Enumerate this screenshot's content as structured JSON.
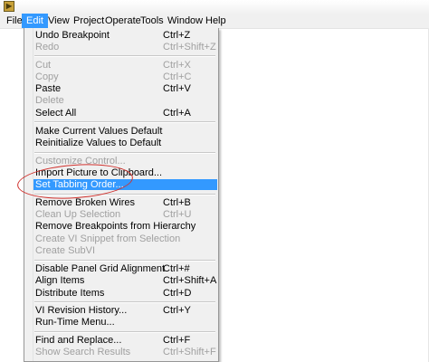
{
  "window": {
    "app_icon": "labview-app-icon"
  },
  "menubar": {
    "items": [
      {
        "label": "File"
      },
      {
        "label": "Edit"
      },
      {
        "label": "View"
      },
      {
        "label": "Project"
      },
      {
        "label": "Operate"
      },
      {
        "label": "Tools"
      },
      {
        "label": "Window"
      },
      {
        "label": "Help"
      }
    ],
    "active_index": 1
  },
  "edit_menu": {
    "items": [
      {
        "label": "Undo Breakpoint",
        "shortcut": "Ctrl+Z",
        "enabled": true
      },
      {
        "label": "Redo",
        "shortcut": "Ctrl+Shift+Z",
        "enabled": false
      },
      {
        "label": "Cut",
        "shortcut": "Ctrl+X",
        "enabled": false
      },
      {
        "label": "Copy",
        "shortcut": "Ctrl+C",
        "enabled": false
      },
      {
        "label": "Paste",
        "shortcut": "Ctrl+V",
        "enabled": true
      },
      {
        "label": "Delete",
        "shortcut": "",
        "enabled": false
      },
      {
        "label": "Select All",
        "shortcut": "Ctrl+A",
        "enabled": true
      },
      {
        "label": "Make Current Values Default",
        "shortcut": "",
        "enabled": true
      },
      {
        "label": "Reinitialize Values to Default",
        "shortcut": "",
        "enabled": true
      },
      {
        "label": "Customize Control...",
        "shortcut": "",
        "enabled": false
      },
      {
        "label": "Import Picture to Clipboard...",
        "shortcut": "",
        "enabled": true
      },
      {
        "label": "Set Tabbing Order...",
        "shortcut": "",
        "enabled": true,
        "highlighted": true
      },
      {
        "label": "Remove Broken Wires",
        "shortcut": "Ctrl+B",
        "enabled": true
      },
      {
        "label": "Clean Up Selection",
        "shortcut": "Ctrl+U",
        "enabled": false
      },
      {
        "label": "Remove Breakpoints from Hierarchy",
        "shortcut": "",
        "enabled": true
      },
      {
        "label": "Create VI Snippet from Selection",
        "shortcut": "",
        "enabled": false
      },
      {
        "label": "Create SubVI",
        "shortcut": "",
        "enabled": false
      },
      {
        "label": "Disable Panel Grid Alignment",
        "shortcut": "Ctrl+#",
        "enabled": true
      },
      {
        "label": "Align Items",
        "shortcut": "Ctrl+Shift+A",
        "enabled": true
      },
      {
        "label": "Distribute Items",
        "shortcut": "Ctrl+D",
        "enabled": true
      },
      {
        "label": "VI Revision History...",
        "shortcut": "Ctrl+Y",
        "enabled": true
      },
      {
        "label": "Run-Time Menu...",
        "shortcut": "",
        "enabled": true
      },
      {
        "label": "Find and Replace...",
        "shortcut": "Ctrl+F",
        "enabled": true
      },
      {
        "label": "Show Search Results",
        "shortcut": "Ctrl+Shift+F",
        "enabled": false
      }
    ]
  },
  "colors": {
    "highlight": "#3399ff",
    "annotation": "#d0312d",
    "disabled_text": "#a0a0a0"
  }
}
